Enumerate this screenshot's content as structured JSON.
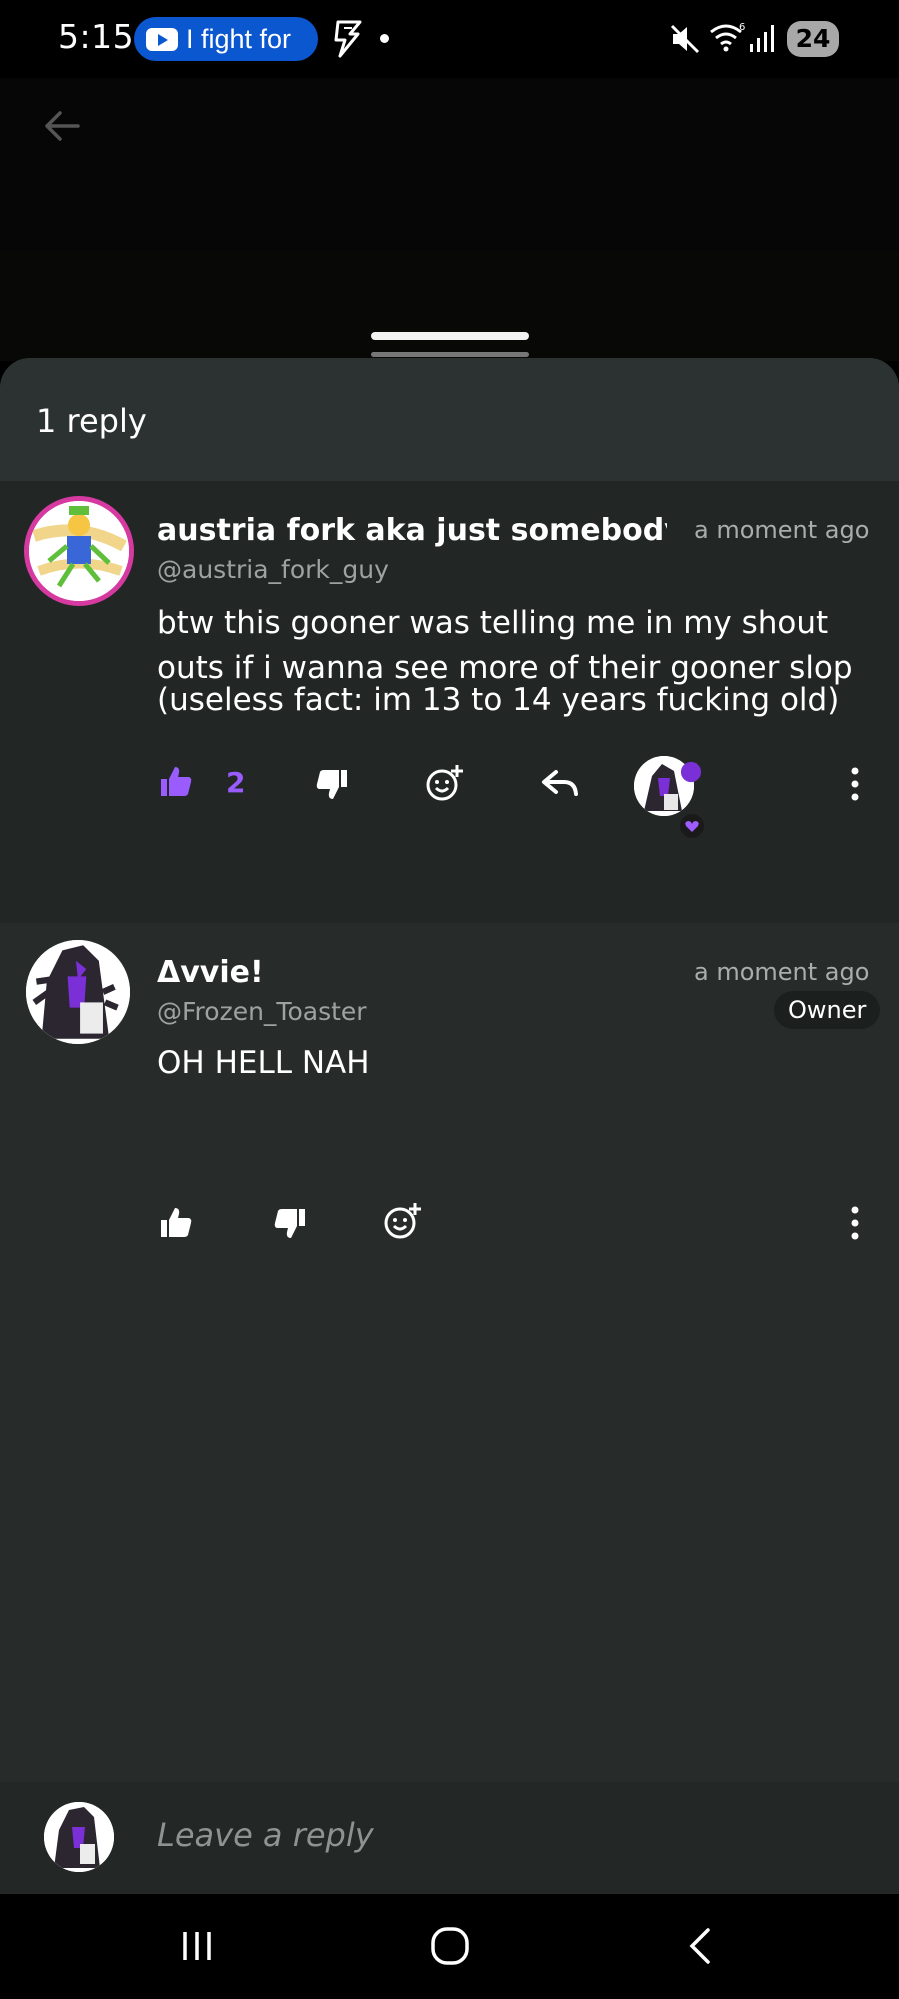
{
  "status_bar": {
    "time": "5:15",
    "media_pill_text": "I fight for",
    "battery": "24",
    "accent_color": "#0b57d0"
  },
  "sheet": {
    "title": "1 reply"
  },
  "parent_comment": {
    "author": "austria fork aka just somebody o",
    "timestamp": "a moment ago",
    "handle": "@austria_fork_guy",
    "body_paragraph_1": "btw this gooner was telling me in my shout outs if i wanna see more of their gooner slop",
    "body_paragraph_2": "(useless fact: im 13 to 14 years fucking old)",
    "like_count": "2",
    "liked": true,
    "like_color": "#9b5cff",
    "icons": [
      "thumbs-up-icon",
      "thumbs-down-icon",
      "add-reaction-icon",
      "reply-icon",
      "more-vert-icon"
    ]
  },
  "reply_comment": {
    "author": "Δvvie!",
    "timestamp": "a moment ago",
    "handle": "@Frozen_Toaster",
    "badge": "Owner",
    "body": "OH HELL NAH",
    "icons": [
      "thumbs-up-icon",
      "thumbs-down-icon",
      "add-reaction-icon",
      "more-vert-icon"
    ]
  },
  "reply_input": {
    "placeholder": "Leave a reply"
  },
  "nav_bar": {
    "icons": [
      "recents-icon",
      "home-icon",
      "back-icon"
    ]
  }
}
